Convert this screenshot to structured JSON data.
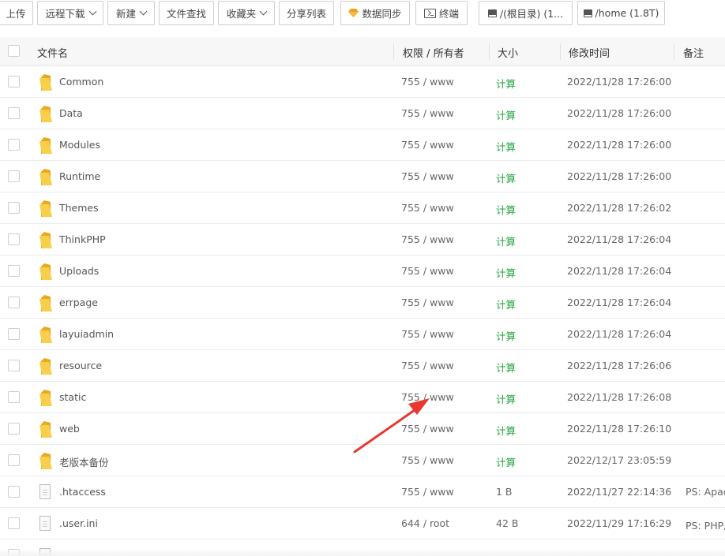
{
  "toolbar": {
    "upload": "上传",
    "remote_download": "远程下载",
    "new": "新建",
    "file_search": "文件查找",
    "favorites": "收藏夹",
    "share_list": "分享列表",
    "data_sync": "数据同步",
    "terminal": "终端",
    "disk_root": "/(根目录) (1...",
    "disk_home": "/home (1.8T)"
  },
  "columns": {
    "name": "文件名",
    "perm": "权限 / 所有者",
    "size": "大小",
    "mtime": "修改时间",
    "note": "备注"
  },
  "rows": [
    {
      "name": "Common",
      "type": "folder",
      "perm": "755 / www",
      "size": "计算",
      "mtime": "2022/11/28 17:26:00",
      "note": ""
    },
    {
      "name": "Data",
      "type": "folder",
      "perm": "755 / www",
      "size": "计算",
      "mtime": "2022/11/28 17:26:00",
      "note": ""
    },
    {
      "name": "Modules",
      "type": "folder",
      "perm": "755 / www",
      "size": "计算",
      "mtime": "2022/11/28 17:26:00",
      "note": ""
    },
    {
      "name": "Runtime",
      "type": "folder",
      "perm": "755 / www",
      "size": "计算",
      "mtime": "2022/11/28 17:26:00",
      "note": ""
    },
    {
      "name": "Themes",
      "type": "folder",
      "perm": "755 / www",
      "size": "计算",
      "mtime": "2022/11/28 17:26:02",
      "note": ""
    },
    {
      "name": "ThinkPHP",
      "type": "folder",
      "perm": "755 / www",
      "size": "计算",
      "mtime": "2022/11/28 17:26:04",
      "note": ""
    },
    {
      "name": "Uploads",
      "type": "folder",
      "perm": "755 / www",
      "size": "计算",
      "mtime": "2022/11/28 17:26:04",
      "note": ""
    },
    {
      "name": "errpage",
      "type": "folder",
      "perm": "755 / www",
      "size": "计算",
      "mtime": "2022/11/28 17:26:04",
      "note": ""
    },
    {
      "name": "layuiadmin",
      "type": "folder",
      "perm": "755 / www",
      "size": "计算",
      "mtime": "2022/11/28 17:26:04",
      "note": ""
    },
    {
      "name": "resource",
      "type": "folder",
      "perm": "755 / www",
      "size": "计算",
      "mtime": "2022/11/28 17:26:06",
      "note": ""
    },
    {
      "name": "static",
      "type": "folder",
      "perm": "755 / www",
      "size": "计算",
      "mtime": "2022/11/28 17:26:08",
      "note": ""
    },
    {
      "name": "web",
      "type": "folder",
      "perm": "755 / www",
      "size": "计算",
      "mtime": "2022/11/28 17:26:10",
      "note": ""
    },
    {
      "name": "老版本备份",
      "type": "folder",
      "perm": "755 / www",
      "size": "计算",
      "mtime": "2022/12/17 23:05:59",
      "note": ""
    },
    {
      "name": ".htaccess",
      "type": "file",
      "perm": "755 / www",
      "size": "1 B",
      "mtime": "2022/11/27 22:14:36",
      "note": "PS: Apac"
    },
    {
      "name": ".user.ini",
      "type": "file",
      "perm": "644 / root",
      "size": "42 B",
      "mtime": "2022/11/29 17:16:29",
      "note": "PS: PHP用"
    }
  ],
  "colors": {
    "calc_green": "#20a53a",
    "folder_yellow": "#f5c542",
    "annotation_arrow": "#e8382f"
  },
  "icons": {
    "data_sync": "gem-icon",
    "terminal": "terminal-icon",
    "disk": "disk-icon",
    "folder": "folder-icon",
    "file": "file-icon",
    "dropdown": "chevron-down-icon"
  }
}
